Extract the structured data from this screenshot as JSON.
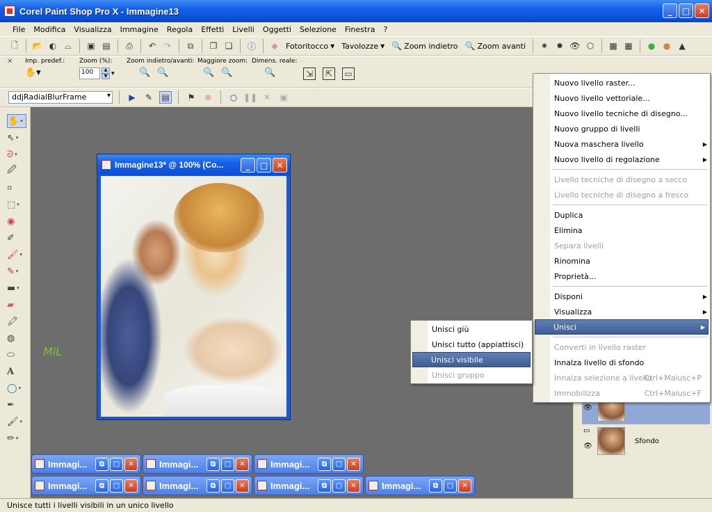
{
  "window": {
    "title": "Corel Paint Shop Pro X - Immagine13"
  },
  "menubar": [
    "File",
    "Modifica",
    "Visualizza",
    "Immagine",
    "Regola",
    "Effetti",
    "Livelli",
    "Oggetti",
    "Selezione",
    "Finestra",
    "?"
  ],
  "toolbar1": {
    "fotoritocco": "Fotoritocco",
    "tavolozze": "Tavolozze",
    "zoom_indietro": "Zoom indietro",
    "zoom_avanti": "Zoom avanti"
  },
  "toolbar2": {
    "imp_predef": "Imp. predef.:",
    "zoom_pct_label": "Zoom (%):",
    "zoom_value": "100",
    "zoom_back_fwd": "Zoom indietro/avanti:",
    "maggiore_zoom": "Maggiore zoom:",
    "dimens_reale": "Dimens. reale:"
  },
  "toolbar3": {
    "preset": "ddjRadialBlurFrame"
  },
  "document": {
    "title": "Immagine13* @ 100% (Co..."
  },
  "watermark": "MiL",
  "minimized_windows": [
    {
      "label": "Immagi..."
    },
    {
      "label": "Immagi..."
    },
    {
      "label": "Immagi..."
    },
    {
      "label": "Immagi..."
    },
    {
      "label": "Immagi..."
    },
    {
      "label": "Immagi..."
    },
    {
      "label": "Immagi..."
    }
  ],
  "layers": {
    "sfondo": "Sfondo"
  },
  "layers_menu": [
    {
      "label": "Nuovo livello raster...",
      "disabled": false
    },
    {
      "label": "Nuovo livello vettoriale...",
      "disabled": false
    },
    {
      "label": "Nuovo livello tecniche di disegno...",
      "disabled": false
    },
    {
      "label": "Nuovo gruppo di livelli",
      "disabled": false
    },
    {
      "label": "Nuova maschera livello",
      "disabled": false,
      "submenu": true
    },
    {
      "label": "Nuovo livello di regolazione",
      "disabled": false,
      "submenu": true
    },
    {
      "sep": true
    },
    {
      "label": "Livello tecniche di disegno a secco",
      "disabled": true
    },
    {
      "label": "Livello tecniche di disegno a fresco",
      "disabled": true
    },
    {
      "sep": true
    },
    {
      "label": "Duplica",
      "disabled": false
    },
    {
      "label": "Elimina",
      "disabled": false
    },
    {
      "label": "Separa livelli",
      "disabled": true
    },
    {
      "label": "Rinomina",
      "disabled": false
    },
    {
      "label": "Proprietà...",
      "disabled": false
    },
    {
      "sep": true
    },
    {
      "label": "Disponi",
      "disabled": false,
      "submenu": true
    },
    {
      "label": "Visualizza",
      "disabled": false,
      "submenu": true
    },
    {
      "label": "Unisci",
      "disabled": false,
      "submenu": true,
      "highlighted": true
    },
    {
      "sep": true
    },
    {
      "label": "Converti in livello raster",
      "disabled": true
    },
    {
      "label": "Innalza livello di sfondo",
      "disabled": false
    },
    {
      "label": "Innalza selezione a livello",
      "disabled": true,
      "shortcut": "Ctrl+Maiusc+P"
    },
    {
      "label": "Immobilizza",
      "disabled": true,
      "shortcut": "Ctrl+Maiusc+F"
    }
  ],
  "unisci_submenu": [
    {
      "label": "Unisci giù",
      "disabled": false
    },
    {
      "label": "Unisci tutto (appiattisci)",
      "disabled": false
    },
    {
      "label": "Unisci visibile",
      "disabled": false,
      "highlighted": true
    },
    {
      "label": "Unisci gruppo",
      "disabled": true
    }
  ],
  "statusbar": "Unisce tutti i livelli visibili in un unico livello",
  "colors": {
    "title_blue": "#0a4fd6",
    "menu_highlight": "#4f6ea5",
    "workspace_gray": "#6d6d6d",
    "watermark_green": "#7ec03a"
  }
}
